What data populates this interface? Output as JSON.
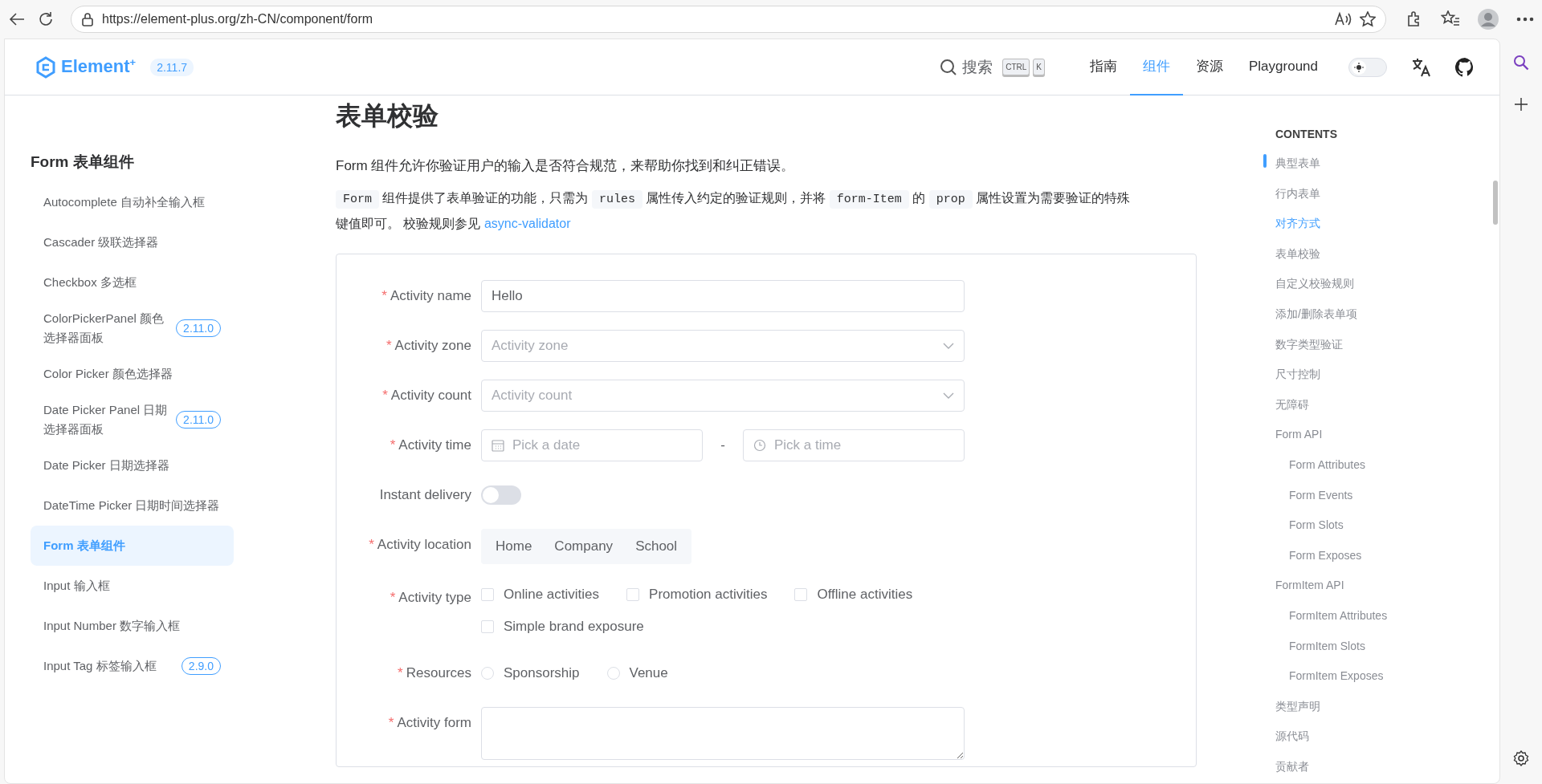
{
  "browser": {
    "url": "https://element-plus.org/zh-CN/component/form"
  },
  "header": {
    "logo": "Element$^{+}$",
    "version": "2.11.7",
    "search": {
      "label": "搜索",
      "keys": [
        "CTRL",
        "K"
      ]
    },
    "nav": [
      {
        "label": "指南",
        "selected": false
      },
      {
        "label": "组件",
        "selected": true
      },
      {
        "label": "资源",
        "selected": false
      },
      {
        "label": "Playground",
        "selected": false
      }
    ],
    "dark_mode": false
  },
  "sidebar": {
    "title": "Form 表单组件",
    "items": [
      {
        "label": "Autocomplete 自动补全输入框",
        "selected": false
      },
      {
        "label": "Cascader 级联选择器",
        "selected": false
      },
      {
        "label": "Checkbox 多选框",
        "selected": false
      },
      {
        "label": "ColorPickerPanel 颜色选择器面板",
        "badge": "2.11.0",
        "selected": false
      },
      {
        "label": "Color Picker 颜色选择器",
        "selected": false
      },
      {
        "label": "Date Picker Panel 日期选择器面板",
        "badge": "2.11.0",
        "selected": false
      },
      {
        "label": "Date Picker 日期选择器",
        "selected": false
      },
      {
        "label": "DateTime Picker 日期时间选择器",
        "selected": false
      },
      {
        "label": "Form 表单组件",
        "selected": true
      },
      {
        "label": "Input 输入框",
        "selected": false
      },
      {
        "label": "Input Number 数字输入框",
        "selected": false
      },
      {
        "label": "Input Tag 标签输入框",
        "badge": "2.9.0",
        "selected": false
      }
    ]
  },
  "content": {
    "title": "表单校验",
    "intro": "Form 组件允许你验证用户的输入是否符合规范，来帮助你找到和纠正错误。",
    "paragraph": [
      {
        "kind": "code",
        "text": "Form"
      },
      {
        "kind": "text",
        "text": " 组件提供了表单验证的功能，只需为 "
      },
      {
        "kind": "code",
        "text": "rules"
      },
      {
        "kind": "text",
        "text": " 属性传入约定的验证规则，并将 "
      },
      {
        "kind": "code",
        "text": "form-Item"
      },
      {
        "kind": "text",
        "text": " 的 "
      },
      {
        "kind": "code",
        "text": "prop"
      },
      {
        "kind": "text",
        "text": " 属性设置为需要验证的特殊键值即可。 校验规则参见 "
      },
      {
        "kind": "link",
        "text": "async-validator"
      }
    ],
    "form": [
      {
        "kind": "input",
        "label": "Activity name",
        "required_mark": "*",
        "value": "Hello"
      },
      {
        "kind": "select",
        "label": "Activity zone",
        "required_mark": "*",
        "placeholder": "Activity zone"
      },
      {
        "kind": "select",
        "label": "Activity count",
        "required_mark": "*",
        "placeholder": "Activity count"
      },
      {
        "kind": "datetime",
        "label": "Activity time",
        "required_mark": "*",
        "date_placeholder": "Pick a date",
        "separator": "-",
        "time_placeholder": "Pick a time"
      },
      {
        "kind": "switch",
        "label": "Instant delivery",
        "on": false
      },
      {
        "kind": "segmented",
        "label": "Activity location",
        "required_mark": "*",
        "options": [
          {
            "label": "Home",
            "selected": false
          },
          {
            "label": "Company",
            "selected": false
          },
          {
            "label": "School",
            "selected": false
          }
        ]
      },
      {
        "kind": "checkbox",
        "label": "Activity type",
        "required_mark": "*",
        "options": [
          {
            "label": "Online activities",
            "checked": false
          },
          {
            "label": "Promotion activities",
            "checked": false
          },
          {
            "label": "Offline activities",
            "checked": false
          },
          {
            "label": "Simple brand exposure",
            "checked": false
          }
        ]
      },
      {
        "kind": "radio",
        "label": "Resources",
        "required_mark": "*",
        "options": [
          {
            "label": "Sponsorship",
            "selected": false
          },
          {
            "label": "Venue",
            "selected": false
          }
        ]
      },
      {
        "kind": "textarea",
        "label": "Activity form",
        "required_mark": "*"
      }
    ]
  },
  "toc": {
    "heading": "CONTENTS",
    "items": [
      {
        "label": "典型表单",
        "selected": false,
        "marker": true
      },
      {
        "label": "行内表单",
        "selected": false,
        "marker": false
      },
      {
        "label": "对齐方式",
        "selected": true,
        "marker": false
      },
      {
        "label": "表单校验",
        "selected": false,
        "marker": false
      },
      {
        "label": "自定义校验规则",
        "selected": false,
        "marker": false
      },
      {
        "label": "添加/删除表单项",
        "selected": false,
        "marker": false
      },
      {
        "label": "数字类型验证",
        "selected": false,
        "marker": false
      },
      {
        "label": "尺寸控制",
        "selected": false,
        "marker": false
      },
      {
        "label": "无障碍",
        "selected": false,
        "marker": false
      },
      {
        "label": "Form API",
        "selected": false,
        "marker": false,
        "children": [
          {
            "label": "Form Attributes",
            "selected": false,
            "marker": false
          },
          {
            "label": "Form Events",
            "selected": false,
            "marker": false
          },
          {
            "label": "Form Slots",
            "selected": false,
            "marker": false
          },
          {
            "label": "Form Exposes",
            "selected": false,
            "marker": false
          }
        ]
      },
      {
        "label": "FormItem API",
        "selected": false,
        "marker": false,
        "children": [
          {
            "label": "FormItem Attributes",
            "selected": false,
            "marker": false
          },
          {
            "label": "FormItem Slots",
            "selected": false,
            "marker": false
          },
          {
            "label": "FormItem Exposes",
            "selected": false,
            "marker": false
          }
        ]
      },
      {
        "label": "类型声明",
        "selected": false,
        "marker": false
      },
      {
        "label": "源代码",
        "selected": false,
        "marker": false
      },
      {
        "label": "贡献者",
        "selected": false,
        "marker": false
      }
    ]
  }
}
